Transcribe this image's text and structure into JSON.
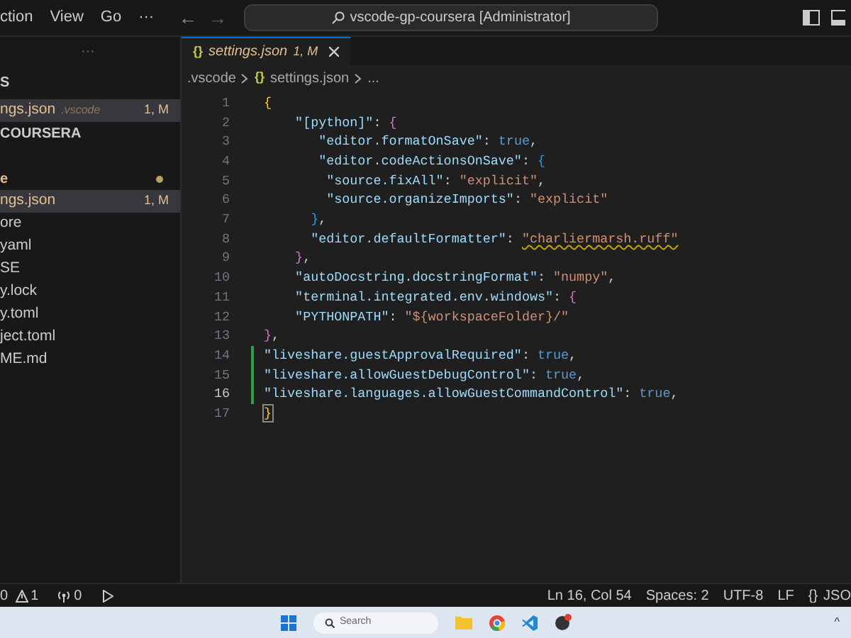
{
  "menu": [
    "ction",
    "View",
    "Go",
    "···"
  ],
  "nav": [
    "←",
    "→"
  ],
  "command_center": {
    "text": "vscode-gp-coursera [Administrator]"
  },
  "sidebar": {
    "actions": "···",
    "section_title": "S",
    "items": [
      {
        "kind": "file",
        "label": "ngs.json",
        "description": ".vscode",
        "badge": "1, M",
        "selected": true,
        "modified": true
      },
      {
        "kind": "folder",
        "label": "COURSERA",
        "selected": false,
        "modified": false
      },
      {
        "kind": "folder",
        "label": "e",
        "selected": false,
        "modified": true,
        "dot": true
      },
      {
        "kind": "file",
        "label": "ngs.json",
        "badge": "1, M",
        "selected": true,
        "modified": true
      },
      {
        "kind": "file",
        "label": "ore",
        "selected": false,
        "modified": false
      },
      {
        "kind": "file",
        "label": "yaml",
        "selected": false,
        "modified": false
      },
      {
        "kind": "file",
        "label": "SE",
        "selected": false,
        "modified": false
      },
      {
        "kind": "file",
        "label": "y.lock",
        "selected": false,
        "modified": false
      },
      {
        "kind": "file",
        "label": "y.toml",
        "selected": false,
        "modified": false
      },
      {
        "kind": "file",
        "label": "ject.toml",
        "selected": false,
        "modified": false
      },
      {
        "kind": "file",
        "label": "ME.md",
        "selected": false,
        "modified": false
      }
    ]
  },
  "tabs": [
    {
      "icon": "{}",
      "label": "settings.json",
      "badge": "1, M",
      "selected": true
    }
  ],
  "breadcrumb": [
    {
      "label": ".vscode"
    },
    {
      "icon": "{}",
      "label": "settings.json"
    },
    {
      "label": "..."
    }
  ],
  "code_lines": [
    {
      "number": "1",
      "added": false,
      "current": false,
      "tokens": [
        {
          "text": "{",
          "kind": "brace1"
        }
      ]
    },
    {
      "number": "2",
      "added": false,
      "current": false,
      "tokens": [
        {
          "text": "    \"[python]\"",
          "kind": "key"
        },
        {
          "text": ": ",
          "kind": "punct"
        },
        {
          "text": "{",
          "kind": "brace2"
        }
      ]
    },
    {
      "number": "3",
      "added": false,
      "current": false,
      "tokens": [
        {
          "text": "       \"editor.formatOnSave\"",
          "kind": "key"
        },
        {
          "text": ": ",
          "kind": "punct"
        },
        {
          "text": "true",
          "kind": "keyword"
        },
        {
          "text": ",",
          "kind": "punct"
        }
      ]
    },
    {
      "number": "4",
      "added": false,
      "current": false,
      "tokens": [
        {
          "text": "       \"editor.codeActionsOnSave\"",
          "kind": "key"
        },
        {
          "text": ": ",
          "kind": "punct"
        },
        {
          "text": "{",
          "kind": "brace3"
        }
      ]
    },
    {
      "number": "5",
      "added": false,
      "current": false,
      "tokens": [
        {
          "text": "        \"source.fixAll\"",
          "kind": "key"
        },
        {
          "text": ": ",
          "kind": "punct"
        },
        {
          "text": "\"explicit\"",
          "kind": "string"
        },
        {
          "text": ",",
          "kind": "punct"
        }
      ]
    },
    {
      "number": "6",
      "added": false,
      "current": false,
      "tokens": [
        {
          "text": "        \"source.organizeImports\"",
          "kind": "key"
        },
        {
          "text": ": ",
          "kind": "punct"
        },
        {
          "text": "\"explicit\"",
          "kind": "string"
        }
      ]
    },
    {
      "number": "7",
      "added": false,
      "current": false,
      "tokens": [
        {
          "text": "      }",
          "kind": "brace3"
        },
        {
          "text": ",",
          "kind": "punct"
        }
      ]
    },
    {
      "number": "8",
      "added": false,
      "current": false,
      "tokens": [
        {
          "text": "      \"editor.defaultFormatter\"",
          "kind": "key"
        },
        {
          "text": ": ",
          "kind": "punct"
        },
        {
          "text": "\"charliermarsh.ruff\"",
          "kind": "warning"
        }
      ]
    },
    {
      "number": "9",
      "added": false,
      "current": false,
      "tokens": [
        {
          "text": "    }",
          "kind": "brace2"
        },
        {
          "text": ",",
          "kind": "punct"
        }
      ]
    },
    {
      "number": "10",
      "added": false,
      "current": false,
      "tokens": [
        {
          "text": "    \"autoDocstring.docstringFormat\"",
          "kind": "key"
        },
        {
          "text": ": ",
          "kind": "punct"
        },
        {
          "text": "\"numpy\"",
          "kind": "string"
        },
        {
          "text": ",",
          "kind": "punct"
        }
      ]
    },
    {
      "number": "11",
      "added": false,
      "current": false,
      "tokens": [
        {
          "text": "    \"terminal.integrated.env.windows\"",
          "kind": "key"
        },
        {
          "text": ": ",
          "kind": "punct"
        },
        {
          "text": "{",
          "kind": "brace2"
        }
      ]
    },
    {
      "number": "12",
      "added": false,
      "current": false,
      "tokens": [
        {
          "text": "    \"PYTHONPATH\"",
          "kind": "key"
        },
        {
          "text": ": ",
          "kind": "punct"
        },
        {
          "text": "\"${workspaceFolder}/\"",
          "kind": "string"
        }
      ]
    },
    {
      "number": "13",
      "added": false,
      "current": false,
      "tokens": [
        {
          "text": "}",
          "kind": "brace2"
        },
        {
          "text": ",",
          "kind": "punct"
        }
      ]
    },
    {
      "number": "14",
      "added": true,
      "current": false,
      "tokens": [
        {
          "text": "\"liveshare.guestApprovalRequired\"",
          "kind": "key"
        },
        {
          "text": ": ",
          "kind": "punct"
        },
        {
          "text": "true",
          "kind": "keyword"
        },
        {
          "text": ",",
          "kind": "punct"
        }
      ]
    },
    {
      "number": "15",
      "added": true,
      "current": false,
      "tokens": [
        {
          "text": "\"liveshare.allowGuestDebugControl\"",
          "kind": "key"
        },
        {
          "text": ": ",
          "kind": "punct"
        },
        {
          "text": "true",
          "kind": "keyword"
        },
        {
          "text": ",",
          "kind": "punct"
        }
      ]
    },
    {
      "number": "16",
      "added": true,
      "current": true,
      "tokens": [
        {
          "text": "\"liveshare.languages.allowGuestCommandControl\"",
          "kind": "key"
        },
        {
          "text": ": ",
          "kind": "punct"
        },
        {
          "text": "true",
          "kind": "keyword"
        },
        {
          "text": ",",
          "kind": "punct"
        }
      ]
    },
    {
      "number": "17",
      "added": false,
      "current": false,
      "tokens": [
        {
          "text": "}",
          "kind": "match"
        }
      ]
    }
  ],
  "status_bar": {
    "left": [
      {
        "kind": "errors",
        "text": "0"
      },
      {
        "kind": "warnings",
        "text": "1"
      },
      {
        "kind": "ports",
        "text": "0"
      },
      {
        "kind": "run"
      }
    ],
    "right": [
      "Ln 16, Col 54",
      "Spaces: 2",
      "UTF-8",
      "LF",
      "{}",
      "JSO"
    ]
  },
  "taskbar": {
    "search_placeholder": "Search",
    "tray_chevron": "^"
  }
}
